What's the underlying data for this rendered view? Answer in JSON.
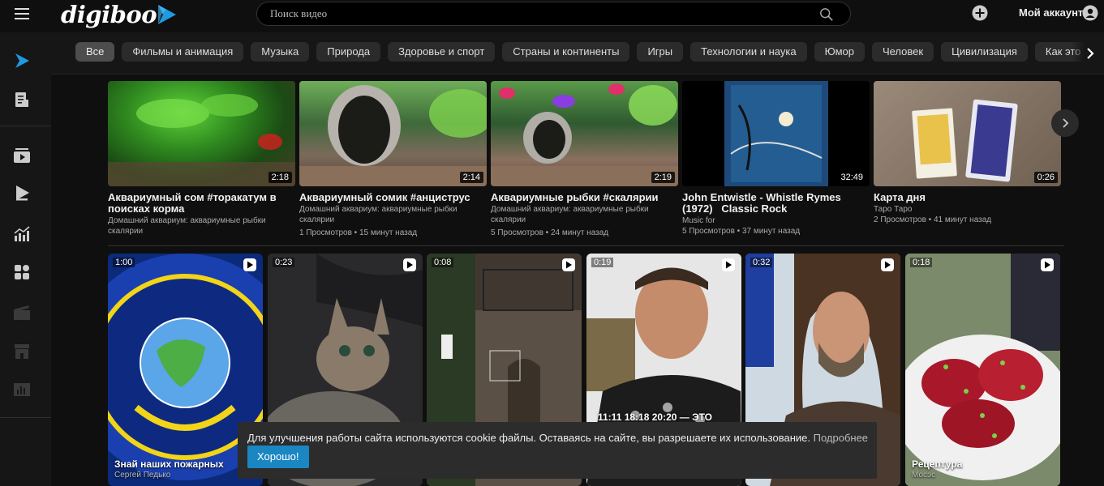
{
  "header": {
    "logo_text": "digiboo",
    "search_placeholder": "Поиск видео",
    "account_label": "Мой аккаунт"
  },
  "sidebar": {
    "items": [
      {
        "icon": "digiboo-play-logo-icon",
        "active": true
      },
      {
        "icon": "document-icon"
      },
      {
        "icon": "playlist-video-icon"
      },
      {
        "icon": "play-icon"
      },
      {
        "icon": "chart-icon"
      },
      {
        "icon": "grid-icon"
      },
      {
        "icon": "clapperboard-icon"
      },
      {
        "icon": "store-icon"
      },
      {
        "icon": "stats-icon"
      }
    ]
  },
  "chips": [
    "Все",
    "Фильмы и анимация",
    "Музыка",
    "Природа",
    "Здоровье и спорт",
    "Страны и континенты",
    "Игры",
    "Технологии и наука",
    "Юмор",
    "Человек",
    "Цивилизация",
    "Как это делается"
  ],
  "videos": [
    {
      "title": "Аквариумный сом #торакатум в поисках корма",
      "channel": "Домашний аквариум: аквариумные рыбки скалярии",
      "meta": "",
      "duration": "2:18"
    },
    {
      "title": "Аквариумный сомик #анциструс",
      "channel": "Домашний аквариум: аквариумные рыбки скалярии",
      "meta": "1 Просмотров • 15 минут назад",
      "duration": "2:14"
    },
    {
      "title": "Аквариумные рыбки #скалярии",
      "channel": "Домашний аквариум: аквариумные рыбки скалярии",
      "meta": "5 Просмотров • 24 минут назад",
      "duration": "2:19"
    },
    {
      "title": "John Entwistle - Whistle Rymes (1972)   Classic Rock",
      "channel": "Music for",
      "meta": "5 Просмотров • 37 минут назад",
      "duration": "32:49"
    },
    {
      "title": "Карта дня",
      "channel": "Таро Таро",
      "meta": "2 Просмотров • 41 минут назад",
      "duration": "0:26"
    }
  ],
  "shorts": [
    {
      "duration": "1:00",
      "title": "Знай наших пожарных",
      "author": "Сергей Педько"
    },
    {
      "duration": "0:23",
      "title": "",
      "author": ""
    },
    {
      "duration": "0:08",
      "title": "",
      "author": ""
    },
    {
      "duration": "0:19",
      "title": "",
      "author": "",
      "overlay": "11:11 18:18 20:20 — ЭТО"
    },
    {
      "duration": "0:32",
      "title": "",
      "author": ""
    },
    {
      "duration": "0:18",
      "title": "Рецептура",
      "author": "Мосэс"
    }
  ],
  "cookie": {
    "text": "Для улучшения работы сайта используются cookie файлы. Оставаясь на сайте, вы разрешаете их использование.",
    "link": "Подробнее",
    "button": "Хорошо!"
  },
  "colors": {
    "accent": "#1a86c2",
    "logo_arrow": "#1e9ae0",
    "background": "#0f0f0f"
  }
}
